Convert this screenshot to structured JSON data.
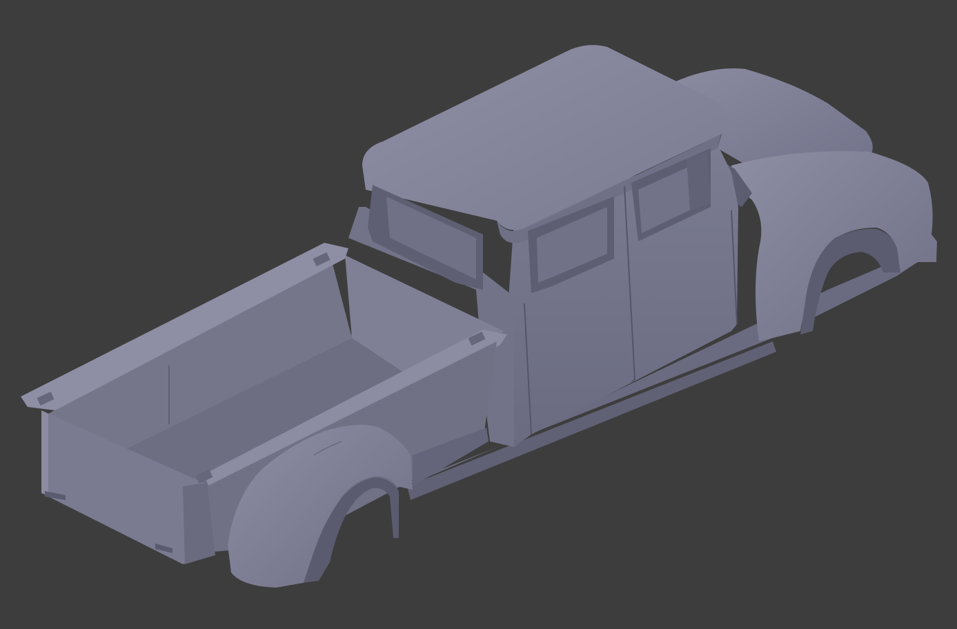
{
  "viewport": {
    "background_color": "#3d3d3d"
  },
  "model": {
    "subject": "pickup-truck-body",
    "body_color": "#7b7c92",
    "shadow_color": "#5a5b6d",
    "highlight_color": "#9a9bb0",
    "interior_color": "#6c6d80",
    "edge_color": "#4a4b5a"
  }
}
